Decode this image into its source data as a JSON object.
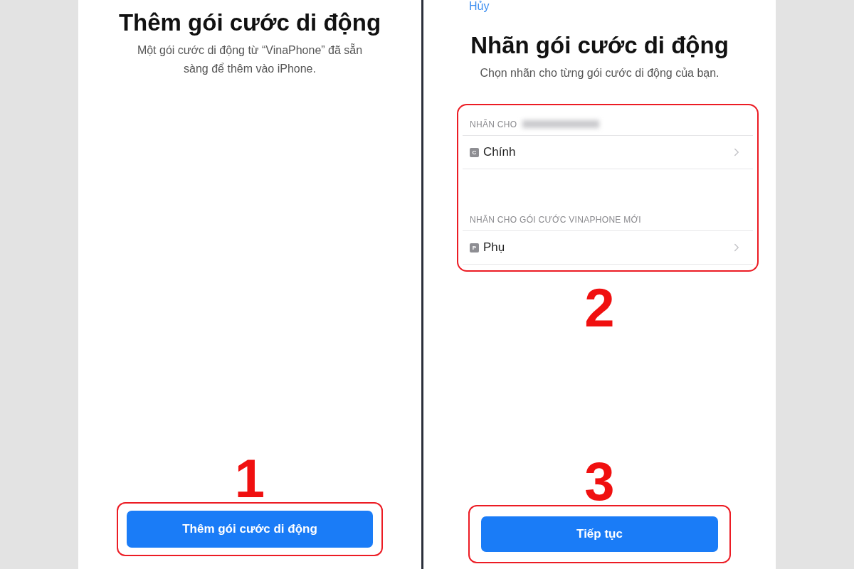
{
  "left_screen": {
    "title": "Thêm gói cước di động",
    "subtitle": "Một gói cước di động từ “VinaPhone” đã sẵn sàng để thêm vào iPhone.",
    "step": "1",
    "button": "Thêm gói cước di động"
  },
  "right_screen": {
    "cancel": "Hủy",
    "title": "Nhãn gói cước di động",
    "subtitle": "Chọn nhãn cho từng gói cước di động của bạn.",
    "sections": [
      {
        "header": "NHÃN CHO",
        "redacted": true,
        "badge": "C",
        "label": "Chính"
      },
      {
        "header": "NHÃN CHO GÓI CƯỚC VINAPHONE MỚI",
        "redacted": false,
        "badge": "P",
        "label": "Phụ"
      }
    ],
    "step_list": "2",
    "step": "3",
    "button": "Tiếp tục"
  }
}
